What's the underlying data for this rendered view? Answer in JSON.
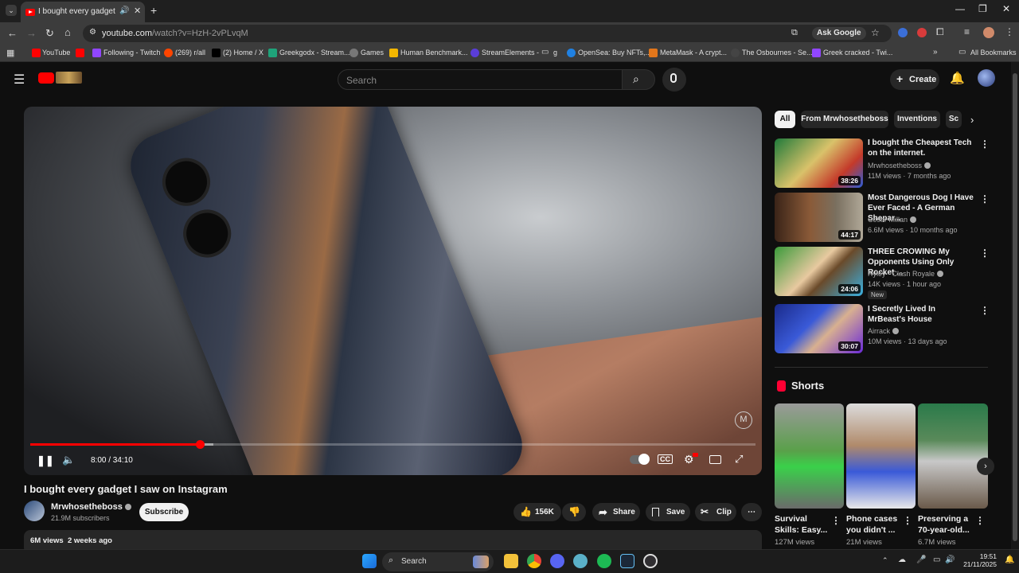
{
  "browser": {
    "tab_title": "I bought every gadget I saw",
    "url_host": "youtube.com",
    "url_path": "/watch?v=HzH-2vPLvqM",
    "ask_google": "Ask Google",
    "bookmarks": [
      "YouTube",
      "Following - Twitch",
      "(269) r/all",
      "(2) Home / X",
      "Greekgodx - Stream...",
      "Games",
      "Human Benchmark...",
      "StreamElements -",
      "g",
      "OpenSea: Buy NFTs,...",
      "MetaMask - A crypt...",
      "The Osbournes - Se...",
      "Greek cracked - Twi..."
    ],
    "all_bookmarks": "All Bookmarks"
  },
  "youtube": {
    "search_placeholder": "Search",
    "create_label": "Create",
    "player": {
      "time": "8:00 / 34:10",
      "played_fraction": 0.234,
      "buffered_fraction": 0.252
    },
    "video": {
      "title": "I bought every gadget I saw on Instagram",
      "channel": "Mrwhosetheboss",
      "subscribers": "21.9M subscribers",
      "subscribe_label": "Subscribe",
      "likes": "156K",
      "share_label": "Share",
      "save_label": "Save",
      "clip_label": "Clip",
      "views": "6M views",
      "age": "2 weeks ago"
    },
    "chips": [
      "All",
      "From Mrwhosetheboss",
      "Inventions",
      "Sc"
    ],
    "recommendations": [
      {
        "title": "I bought the Cheapest Tech on the internet.",
        "channel": "Mrwhosetheboss",
        "meta": "11M views · 7 months ago",
        "duration": "38:26"
      },
      {
        "title": "Most Dangerous Dog I Have Ever Faced - A German Shepar...",
        "channel": "Cesar Millan",
        "meta": "6.6M views · 10 months ago",
        "duration": "44:17"
      },
      {
        "title": "THREE CROWING My Opponents Using Only Rocket ...",
        "channel": "Ryley - Clash Royale",
        "meta": "14K views · 1 hour ago",
        "duration": "24:06",
        "badge": "New"
      },
      {
        "title": "I Secretly Lived In MrBeast's House",
        "channel": "Airrack",
        "meta": "10M views · 13 days ago",
        "duration": "30:07"
      }
    ],
    "shorts_heading": "Shorts",
    "shorts": [
      {
        "title": "Survival Skills: Easy...",
        "views": "127M views"
      },
      {
        "title": "Phone cases you didn't ...",
        "views": "21M views"
      },
      {
        "title": "Preserving a 70-year-old...",
        "views": "6.7M views"
      }
    ]
  },
  "taskbar": {
    "search_label": "Search",
    "time": "19:51",
    "date": "21/11/2025"
  }
}
